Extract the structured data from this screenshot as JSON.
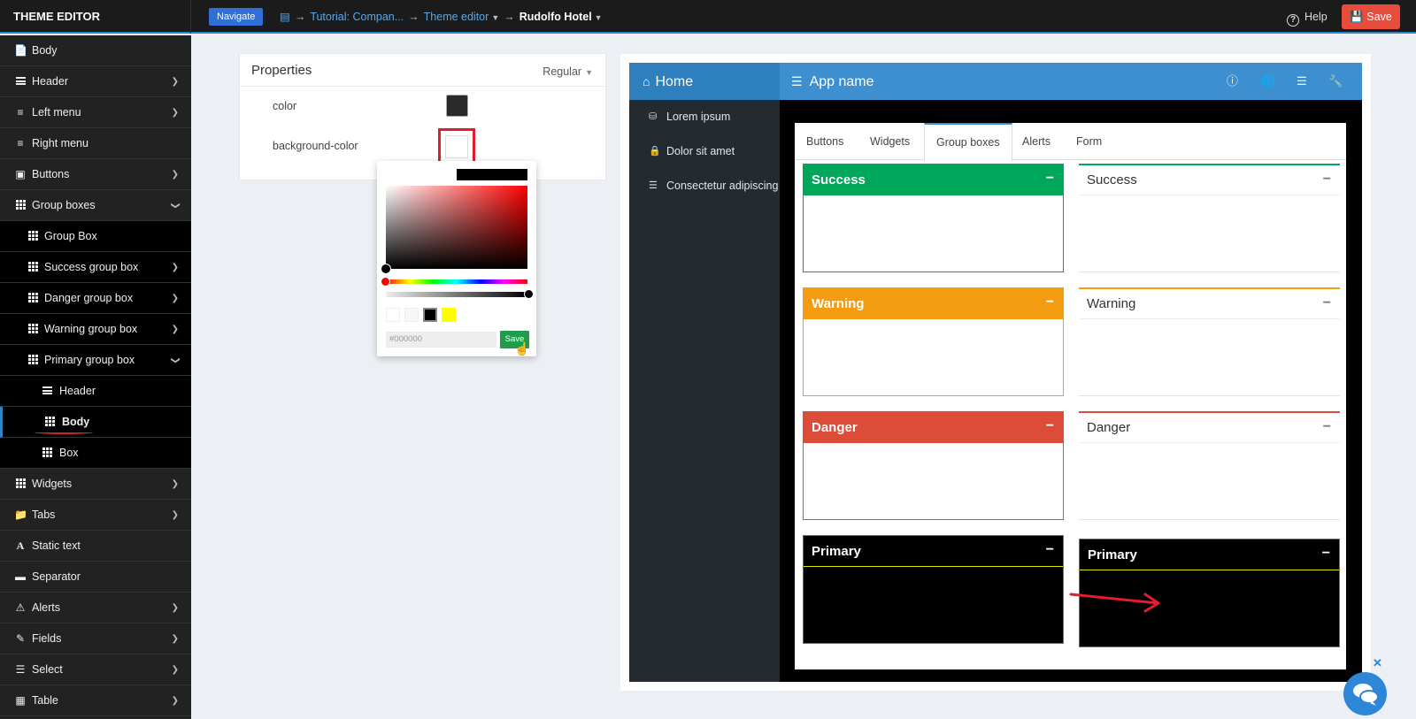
{
  "topbar": {
    "brand": "THEME EDITOR",
    "navigate_label": "Navigate",
    "breadcrumb": [
      "Tutorial: Compan...",
      "Theme editor",
      "Rudolfo Hotel"
    ],
    "help_label": "Help",
    "save_label": "Save",
    "accent": "#2e86c1",
    "save_color": "#e74c3c"
  },
  "sidebar": {
    "items": [
      {
        "label": "Body",
        "icon": "file-icon"
      },
      {
        "label": "Header",
        "icon": "bars-icon"
      },
      {
        "label": "Left menu",
        "icon": "left-menu-icon"
      },
      {
        "label": "Right menu",
        "icon": "right-menu-icon"
      },
      {
        "label": "Buttons",
        "icon": "button-icon"
      },
      {
        "label": "Group boxes",
        "icon": "grid-icon"
      },
      {
        "label": "Group Box",
        "icon": "grid-icon"
      },
      {
        "label": "Success group box",
        "icon": "grid-icon"
      },
      {
        "label": "Danger group box",
        "icon": "grid-icon"
      },
      {
        "label": "Warning group box",
        "icon": "grid-icon"
      },
      {
        "label": "Primary group box",
        "icon": "grid-icon"
      },
      {
        "label": "Header",
        "icon": "bars-icon"
      },
      {
        "label": "Body",
        "icon": "grid-icon"
      },
      {
        "label": "Box",
        "icon": "grid-icon"
      },
      {
        "label": "Widgets",
        "icon": "grid-icon"
      },
      {
        "label": "Tabs",
        "icon": "folder-icon"
      },
      {
        "label": "Static text",
        "icon": "text-icon"
      },
      {
        "label": "Separator",
        "icon": "minus-icon"
      },
      {
        "label": "Alerts",
        "icon": "warning-icon"
      },
      {
        "label": "Fields",
        "icon": "edit-icon"
      },
      {
        "label": "Select",
        "icon": "list-icon"
      },
      {
        "label": "Table",
        "icon": "table-icon"
      }
    ]
  },
  "properties": {
    "title": "Properties",
    "mode": "Regular",
    "rows": [
      {
        "label": "color",
        "value_color": "#2a2a2a"
      },
      {
        "label": "background-color",
        "value_color": "#ffffff"
      }
    ]
  },
  "picker": {
    "hex_placeholder": "#000000",
    "save_label": "Save",
    "swatches": [
      "#ffffff",
      "#f7f7f7",
      "#000000",
      "#ffff00"
    ]
  },
  "preview": {
    "home_label": "Home",
    "app_name": "App name",
    "menu": [
      "Lorem ipsum",
      "Dolor sit amet",
      "Consectetur adipiscing"
    ],
    "tabs": [
      "Buttons",
      "Widgets",
      "Group boxes",
      "Alerts",
      "Form"
    ],
    "active_tab": "Group boxes",
    "boxes": [
      {
        "title": "Success",
        "style": "solid",
        "color": "#00a65a"
      },
      {
        "title": "Success",
        "style": "plain",
        "color": "#00a65a"
      },
      {
        "title": "Warning",
        "style": "solid",
        "color": "#f39c12"
      },
      {
        "title": "Warning",
        "style": "plain",
        "color": "#f39c12"
      },
      {
        "title": "Danger",
        "style": "solid",
        "color": "#dd4b39"
      },
      {
        "title": "Danger",
        "style": "plain",
        "color": "#dd4b39"
      },
      {
        "title": "Primary",
        "style": "primary",
        "color": "#3c8dbc"
      },
      {
        "title": "Primary",
        "style": "primary",
        "color": "#3c8dbc"
      }
    ],
    "minimize_symbol": "−"
  }
}
